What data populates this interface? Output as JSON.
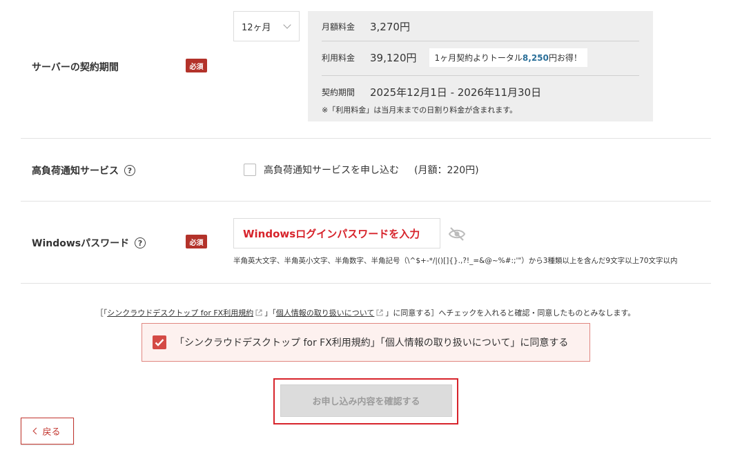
{
  "contract_period": {
    "label": "サーバーの契約期間",
    "required_badge": "必須",
    "select_value": "12ヶ月",
    "monthly_fee_label": "月額料金",
    "monthly_fee_value": "3,270円",
    "usage_fee_label": "利用料金",
    "usage_fee_value": "39,120円",
    "promo_prefix": "1ヶ月契約よりトータル",
    "promo_amount": "8,250",
    "promo_suffix": "円お得！",
    "period_label": "契約期間",
    "period_value": "2025年12月1日 - 2026年11月30日",
    "note": "※「利用料金」は当月末までの日割り料金が含まれます。"
  },
  "high_load": {
    "label": "高負荷通知サービス",
    "checkbox_label": "高負荷通知サービスを申し込む",
    "price": "(月額：220円)"
  },
  "windows_password": {
    "label": "Windowsパスワード",
    "required_badge": "必須",
    "placeholder": "Windowsログインパスワードを入力",
    "hint": "半角英大文字、半角英小文字、半角数字、半角記号（\\^$+-*/|()[]{}.,?!_=&@~%#:;'\"）から3種類以上を含んだ9文字以上70文字以内"
  },
  "agreement": {
    "note_start": "［「",
    "link1": "シンクラウドデスクトップ for FX利用規約",
    "note_mid1": "」「",
    "link2": "個人情報の取り扱いについて",
    "note_end": "」に同意する］へチェックを入れると確認・同意したものとみなします。",
    "checkbox_label": "「シンクラウドデスクトップ for FX利用規約」「個人情報の取り扱いについて」に同意する"
  },
  "actions": {
    "confirm_label": "お申し込み内容を確認する",
    "back_label": "戻る"
  }
}
